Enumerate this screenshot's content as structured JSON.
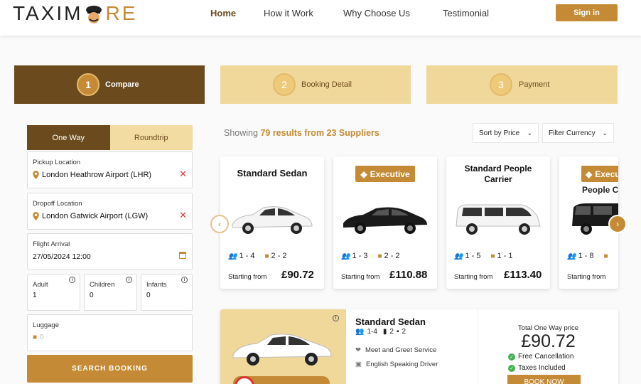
{
  "header": {
    "logo_part1": "TAXIM",
    "logo_part2": "RE",
    "nav": [
      "Home",
      "How it Work",
      "Why Choose Us",
      "Testimonial"
    ],
    "signin": "Sign in"
  },
  "steps": [
    {
      "num": "1",
      "label": "Compare"
    },
    {
      "num": "2",
      "label": "Booking Detail"
    },
    {
      "num": "3",
      "label": "Payment"
    }
  ],
  "form": {
    "tabs": [
      "One Way",
      "Roundtrip"
    ],
    "pickup": {
      "label": "Pickup Location",
      "value": "London Heathrow Airport (LHR)"
    },
    "dropoff": {
      "label": "Dropoff Location",
      "value": "London Gatwick Airport (LGW)"
    },
    "flight": {
      "label": "Flight Arrival",
      "value": "27/05/2024 12:00"
    },
    "adult": {
      "label": "Adult",
      "value": "1"
    },
    "children": {
      "label": "Children",
      "value": "0"
    },
    "infants": {
      "label": "Infants",
      "value": "0"
    },
    "luggage": {
      "label": "Luggage",
      "value": "0"
    },
    "search": "SEARCH BOOKING"
  },
  "results": {
    "prefix": "Showing",
    "count_text": "79 results from 23 Suppliers",
    "sort": "Sort by Price",
    "filter": "Filter Currency"
  },
  "cards": [
    {
      "title": "Standard Sedan",
      "badge": "",
      "pax": "1 - 4",
      "bags": "2 - 2",
      "from": "Starting from",
      "price": "£90.72"
    },
    {
      "title": "",
      "badge": "Executive",
      "pax": "1 - 3",
      "bags": "2 - 2",
      "from": "Starting from",
      "price": "£110.88"
    },
    {
      "title": "Standard People Carrier",
      "badge": "",
      "pax": "1 - 5",
      "bags": "1 - 1",
      "from": "Starting from",
      "price": "£113.40"
    },
    {
      "title": "People Ca",
      "badge": "Execu",
      "pax": "1 - 8",
      "bags": "",
      "from": "Starting from",
      "price": ""
    }
  ],
  "detail": {
    "title": "Standard Sedan",
    "pax": "1-4",
    "bags": "2",
    "lug": "2",
    "feat1": "Meet and Greet Service",
    "feat2": "English Speaking Driver",
    "total_label": "Total One Way price",
    "total": "£90.72",
    "chk1": "Free Cancellation",
    "chk2": "Taxes Included",
    "book": "BOOK NOW"
  },
  "colors": {
    "brown": "#6b4a1e",
    "gold": "#c48a35",
    "beige": "#f0d89b"
  }
}
